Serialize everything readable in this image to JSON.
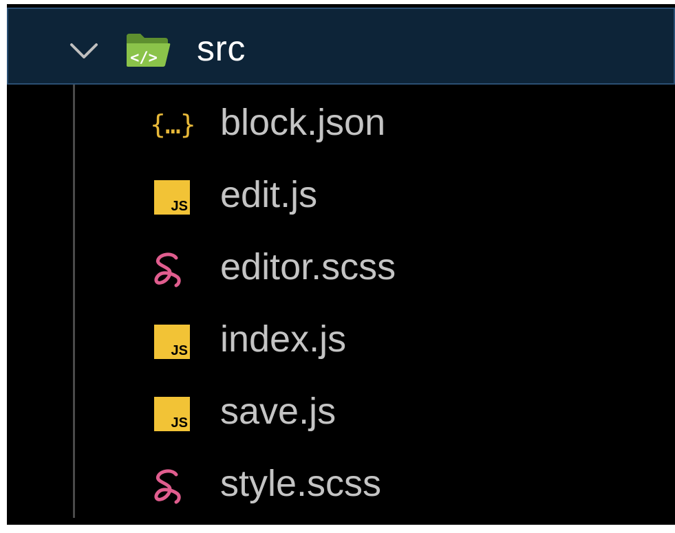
{
  "explorer": {
    "folder": {
      "name": "src",
      "expanded": true,
      "icon": "folder-open-code-icon",
      "icon_color": "#7cb342"
    },
    "files": [
      {
        "name": "block.json",
        "icon": "json-braces-icon",
        "icon_color": "#e7b839"
      },
      {
        "name": "edit.js",
        "icon": "javascript-icon",
        "icon_color": "#f2c336",
        "badge": "JS"
      },
      {
        "name": "editor.scss",
        "icon": "sass-icon",
        "icon_color": "#e05d8e"
      },
      {
        "name": "index.js",
        "icon": "javascript-icon",
        "icon_color": "#f2c336",
        "badge": "JS"
      },
      {
        "name": "save.js",
        "icon": "javascript-icon",
        "icon_color": "#f2c336",
        "badge": "JS"
      },
      {
        "name": "style.scss",
        "icon": "sass-icon",
        "icon_color": "#e05d8e"
      }
    ],
    "json_glyph": "{…}"
  },
  "colors": {
    "background": "#000000",
    "selected_row": "#0d2438",
    "selected_border": "#2b4f73",
    "text": "#c4c4c4"
  }
}
